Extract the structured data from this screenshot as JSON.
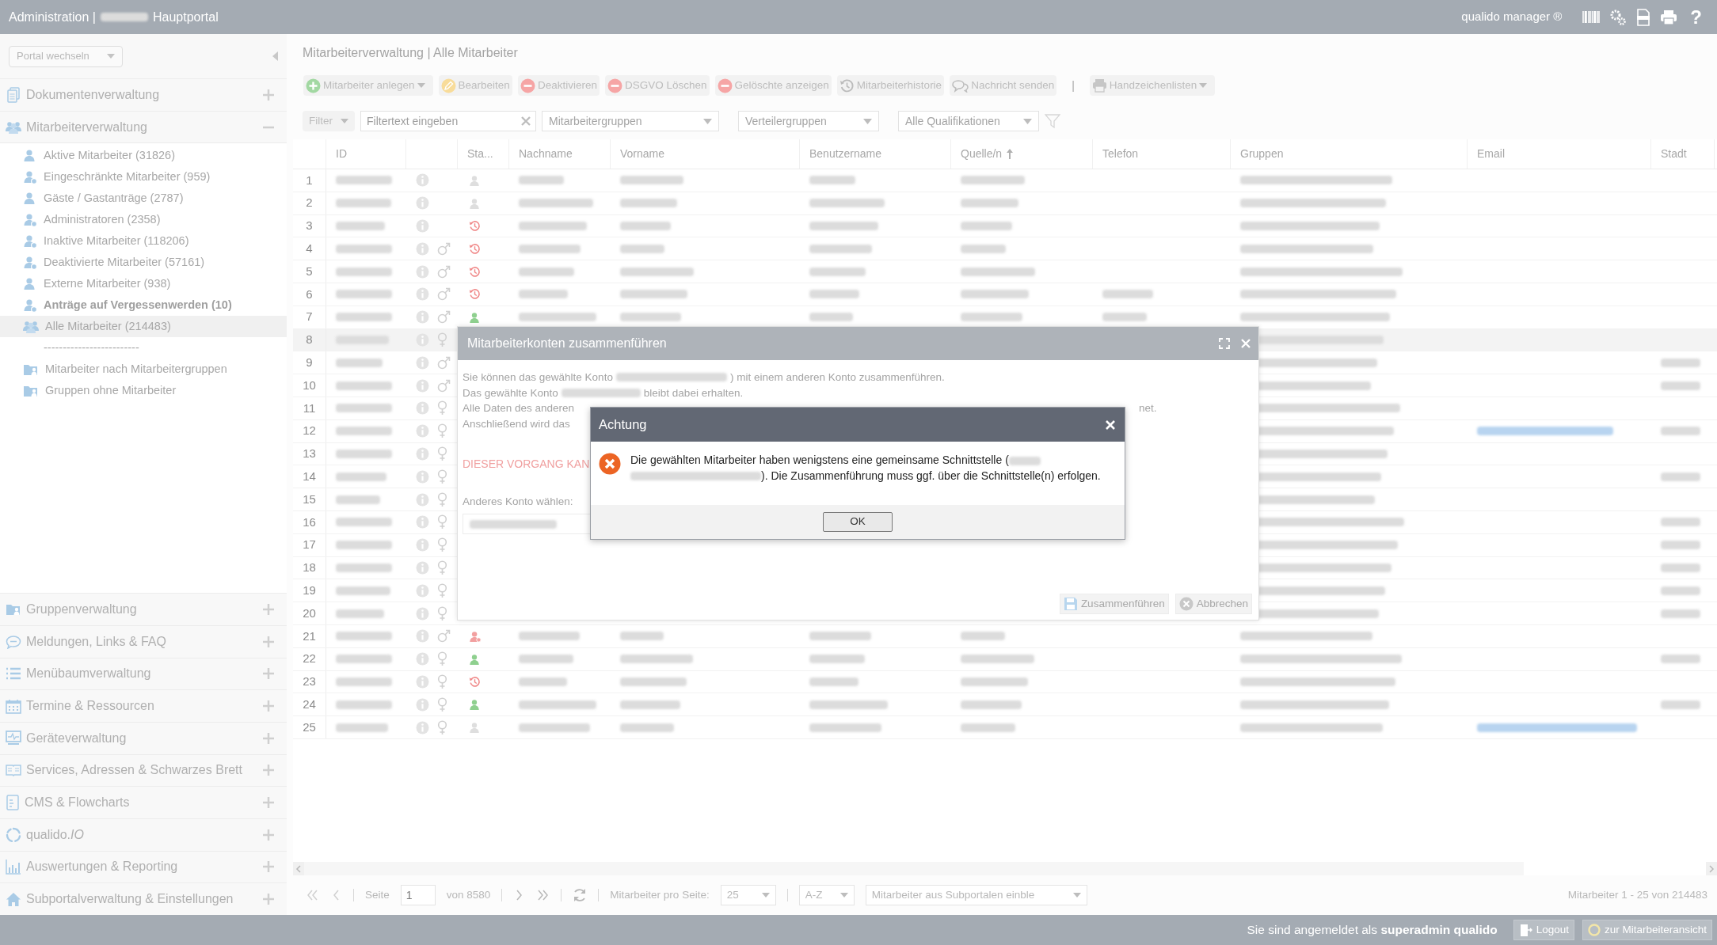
{
  "top_bar": {
    "title_start": "Administration |",
    "title_end": "Hauptportal",
    "product": "qualido manager ®",
    "help": "?"
  },
  "sidebar": {
    "portal_select": "Portal wechseln",
    "sections": [
      {
        "label": "Dokumentenverwaltung",
        "kind": "documents",
        "expanded": false
      },
      {
        "label": "Mitarbeiterverwaltung",
        "kind": "users",
        "expanded": true,
        "items": [
          {
            "label": "Aktive Mitarbeiter (31826)",
            "kind": "user",
            "emphasized": false,
            "selected": false
          },
          {
            "label": "Eingeschränkte Mitarbeiter (959)",
            "kind": "user_badge",
            "emphasized": false,
            "selected": false
          },
          {
            "label": "Gäste / Gastanträge (2787)",
            "kind": "user",
            "emphasized": false,
            "selected": false
          },
          {
            "label": "Administratoren (2358)",
            "kind": "user_badge",
            "emphasized": false,
            "selected": false
          },
          {
            "label": "Inaktive Mitarbeiter (118206)",
            "kind": "user_badge",
            "emphasized": false,
            "selected": false
          },
          {
            "label": "Deaktivierte Mitarbeiter (57161)",
            "kind": "user_badge",
            "emphasized": false,
            "selected": false
          },
          {
            "label": "Externe Mitarbeiter (938)",
            "kind": "user",
            "emphasized": false,
            "selected": false
          },
          {
            "label": "Anträge auf Vergessenwerden (10)",
            "kind": "user_badge",
            "emphasized": true,
            "selected": false
          },
          {
            "label": "Alle Mitarbeiter (214483)",
            "kind": "users",
            "emphasized": false,
            "selected": true
          },
          {
            "label": "-------------------------",
            "kind": "separator",
            "emphasized": false,
            "selected": false
          },
          {
            "label": "Mitarbeiter nach Mitarbeitergruppen",
            "kind": "folder",
            "emphasized": false,
            "selected": false
          },
          {
            "label": "Gruppen ohne Mitarbeiter",
            "kind": "folder",
            "emphasized": false,
            "selected": false
          }
        ]
      },
      {
        "label": "Gruppenverwaltung",
        "kind": "folder",
        "expanded": false
      },
      {
        "label": "Meldungen, Links & FAQ",
        "kind": "chat",
        "expanded": false
      },
      {
        "label": "Menübaumverwaltung",
        "kind": "list",
        "expanded": false
      },
      {
        "label": "Termine & Ressourcen",
        "kind": "calendar",
        "expanded": false
      },
      {
        "label": "Geräteverwaltung",
        "kind": "monitor",
        "expanded": false
      },
      {
        "label": "Services, Adressen & Schwarzes Brett",
        "kind": "book",
        "expanded": false
      },
      {
        "label": "CMS & Flowcharts",
        "kind": "document",
        "expanded": false
      },
      {
        "label": "qualido.*IO*",
        "kind": "ring",
        "expanded": false
      },
      {
        "label": "Auswertungen & Reporting",
        "kind": "chart",
        "expanded": false
      },
      {
        "label": "Subportalverwaltung & Einstellungen",
        "kind": "home",
        "expanded": false
      }
    ]
  },
  "breadcrumb": "Mitarbeiterverwaltung | Alle Mitarbeiter",
  "toolbar": [
    {
      "label": "Mitarbeiter anlegen",
      "kind": "plus",
      "dropdown": true
    },
    {
      "label": "Bearbeiten",
      "kind": "pencil",
      "dropdown": false
    },
    {
      "label": "Deaktivieren",
      "kind": "minus",
      "dropdown": false
    },
    {
      "label": "DSGVO Löschen",
      "kind": "minus",
      "dropdown": false
    },
    {
      "label": "Gelöschte anzeigen",
      "kind": "minus",
      "dropdown": false
    },
    {
      "label": "Mitarbeiterhistorie",
      "kind": "history",
      "dropdown": false
    },
    {
      "label": "Nachricht senden",
      "kind": "chat",
      "dropdown": false
    },
    {
      "label": "|",
      "kind": "separator"
    },
    {
      "label": "Handzeichenlisten",
      "kind": "printer",
      "dropdown": true
    }
  ],
  "filters": {
    "filter_button": "Filter",
    "text_placeholder": "Filtertext eingeben",
    "selects": [
      "Mitarbeitergruppen",
      "Verteilergruppen",
      "Alle Qualifikationen"
    ]
  },
  "table": {
    "columns": [
      {
        "kind": "number"
      },
      {
        "kind": "text",
        "label": "ID"
      },
      {
        "kind": "icons"
      },
      {
        "kind": "status",
        "label": "Sta..."
      },
      {
        "kind": "text",
        "label": "Nachname"
      },
      {
        "kind": "text",
        "label": "Vorname"
      },
      {
        "kind": "text",
        "label": "Benutzername"
      },
      {
        "kind": "text",
        "label": "Quelle/n",
        "sorted": true
      },
      {
        "kind": "text",
        "label": "Telefon"
      },
      {
        "kind": "text",
        "label": "Gruppen"
      },
      {
        "kind": "link",
        "label": "Email"
      },
      {
        "kind": "text",
        "label": "Stadt"
      }
    ],
    "rows": [
      {
        "num": "1",
        "male": false,
        "female": false,
        "kind": "neutral",
        "selected": false,
        "covered": false
      },
      {
        "num": "2",
        "male": false,
        "female": false,
        "kind": "neutral",
        "selected": false,
        "covered": false
      },
      {
        "num": "3",
        "male": false,
        "female": false,
        "kind": "history",
        "selected": false,
        "covered": false
      },
      {
        "num": "4",
        "male": true,
        "female": false,
        "kind": "history",
        "selected": false,
        "covered": false
      },
      {
        "num": "5",
        "male": true,
        "female": false,
        "kind": "history",
        "selected": false,
        "covered": false
      },
      {
        "num": "6",
        "male": true,
        "female": false,
        "kind": "history",
        "selected": false,
        "covered": false
      },
      {
        "num": "7",
        "male": true,
        "female": false,
        "kind": "active",
        "selected": false,
        "covered": false
      },
      {
        "num": "8",
        "male": false,
        "female": true,
        "selected": true,
        "covered": true
      },
      {
        "num": "9",
        "male": true,
        "female": false,
        "selected": false,
        "covered": true
      },
      {
        "num": "10",
        "male": true,
        "female": false,
        "selected": false,
        "covered": true
      },
      {
        "num": "11",
        "male": false,
        "female": true,
        "selected": false,
        "covered": true
      },
      {
        "num": "12",
        "male": false,
        "female": true,
        "selected": false,
        "covered": true
      },
      {
        "num": "13",
        "male": false,
        "female": true,
        "selected": false,
        "covered": true
      },
      {
        "num": "14",
        "male": false,
        "female": true,
        "selected": false,
        "covered": true
      },
      {
        "num": "15",
        "male": false,
        "female": true,
        "selected": false,
        "covered": true
      },
      {
        "num": "16",
        "male": false,
        "female": true,
        "selected": false,
        "covered": true
      },
      {
        "num": "17",
        "male": false,
        "female": true,
        "selected": false,
        "covered": true
      },
      {
        "num": "18",
        "male": false,
        "female": true,
        "selected": false,
        "covered": true
      },
      {
        "num": "19",
        "male": false,
        "female": true,
        "selected": false,
        "covered": true
      },
      {
        "num": "20",
        "male": false,
        "female": true,
        "selected": false,
        "covered": true
      },
      {
        "num": "21",
        "male": true,
        "female": false,
        "kind": "restricted",
        "selected": false,
        "covered": false
      },
      {
        "num": "22",
        "male": false,
        "female": true,
        "kind": "active",
        "selected": false,
        "covered": false
      },
      {
        "num": "23",
        "male": false,
        "female": true,
        "kind": "history",
        "selected": false,
        "covered": false
      },
      {
        "num": "24",
        "male": false,
        "female": true,
        "kind": "active",
        "selected": false,
        "covered": false
      },
      {
        "num": "25",
        "male": false,
        "female": true,
        "kind": "neutral",
        "selected": false,
        "covered": false
      }
    ]
  },
  "pagination": {
    "page_label": "Seite",
    "page": "1",
    "of_pages": "von 8580",
    "per_page_label": "Mitarbeiter pro Seite:",
    "per_page": "25",
    "sort": "A-Z",
    "subportals": "Mitarbeiter aus Subportalen einble",
    "summary": "Mitarbeiter 1 - 25 von 214483"
  },
  "status_bar": {
    "login_text": "Sie sind angemeldet als **superadmin qualido**",
    "buttons": [
      {
        "label": "Logout",
        "kind": "logout"
      },
      {
        "label": "zur Mitarbeiteransicht",
        "kind": "circle"
      }
    ]
  },
  "merge_dialog": {
    "title": "Mitarbeiterkonten zusammenführen",
    "line1_start": "Sie können das gewählte Konto",
    "line1_end": ") mit einem anderen Konto zusammenführen.",
    "line2_start": "Das gewählte Konto",
    "line2_end": "bleibt dabei erhalten.",
    "line3_start": "Alle Daten des anderen",
    "line3_end": "net.",
    "line4": "Anschließend wird das",
    "warning": "DIESER VORGANG KAN",
    "choose_label": "Anderes Konto wählen:",
    "buttons": [
      {
        "label": "Zusammenführen",
        "kind": "save"
      },
      {
        "label": "Abbrechen",
        "kind": "cancel"
      }
    ]
  },
  "alert": {
    "title": "Achtung",
    "message_start": "Die gewählten Mitarbeiter haben wenigstens eine gemeinsame Schnittstelle (",
    "message_end": "). Die Zusammenführung muss ggf. über die Schnittstelle(n) erfolgen.",
    "button": "OK"
  }
}
